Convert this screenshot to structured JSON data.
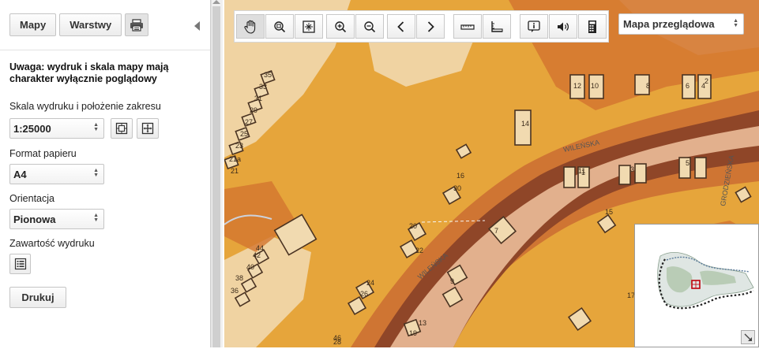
{
  "panel": {
    "tabs": {
      "maps": "Mapy",
      "layers": "Warstwy"
    },
    "warning": "Uwaga: wydruk i skala mapy mają charakter wyłącznie poglądowy",
    "scale_label": "Skala wydruku i położenie zakresu",
    "scale_value": "1:25000",
    "paper_label": "Format papieru",
    "paper_value": "A4",
    "orientation_label": "Orientacja",
    "orientation_value": "Pionowa",
    "content_label": "Zawartość wydruku",
    "print_label": "Drukuj"
  },
  "toolbar": {
    "tools": [
      "hand-icon",
      "zoom-box-out-icon",
      "full-extent-icon",
      "zoom-in-icon",
      "zoom-out-icon",
      "previous-view-icon",
      "next-view-icon",
      "measure-distance-icon",
      "measure-area-icon",
      "info-icon",
      "sound-icon",
      "calculator-icon"
    ]
  },
  "layer_select": {
    "value": "Mapa przeglądowa"
  },
  "map": {
    "street_labels": [
      "WILEŃSKA",
      "WILEŃSKA",
      "GRODZIEŃSKA"
    ],
    "numbers": [
      "35",
      "33",
      "31",
      "29",
      "27",
      "25",
      "23",
      "21a",
      "21",
      "14",
      "12",
      "10",
      "8",
      "6",
      "4",
      "2",
      "16",
      "20",
      "22",
      "24",
      "26",
      "28",
      "30",
      "1",
      "3",
      "5",
      "7",
      "9",
      "11",
      "13",
      "15",
      "17",
      "19",
      "36",
      "38",
      "40",
      "42",
      "44",
      "46"
    ]
  }
}
